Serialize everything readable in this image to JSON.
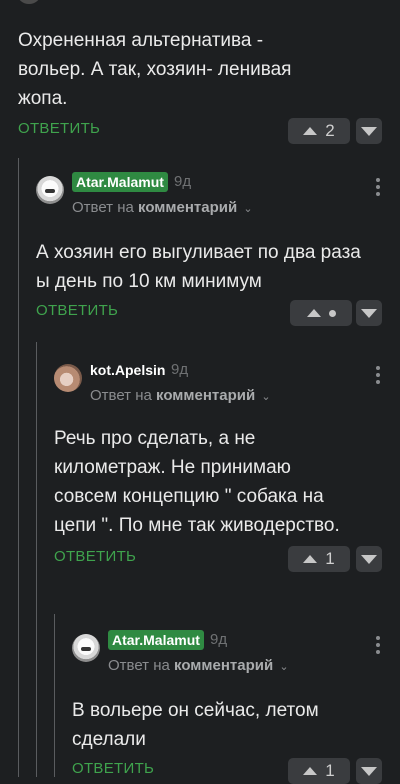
{
  "comments": [
    {
      "body": "Охрененная альтернатива - вольер. А так, хозяин- ленивая жопа.",
      "reply_label": "ОТВЕТИТЬ",
      "rating": "2"
    },
    {
      "username": "Atar.Malamut",
      "time": "9д",
      "reply_prefix": "Ответ на",
      "reply_target": "комментарий",
      "body": "А хозяин его выгуливает по два раза ы день по 10 км минимум",
      "reply_label": "ОТВЕТИТЬ",
      "rating": ""
    },
    {
      "username": "kot.Apelsin",
      "time": "9д",
      "reply_prefix": "Ответ на",
      "reply_target": "комментарий",
      "body": "Речь про сделать, а не километраж. Не принимаю совсем концепцию \" собака на цепи \". По мне так живодерство.",
      "reply_label": "ОТВЕТИТЬ",
      "rating": "1"
    },
    {
      "username": "Atar.Malamut",
      "time": "9д",
      "reply_prefix": "Ответ на",
      "reply_target": "комментарий",
      "body": "В вольере он сейчас, летом сделали",
      "reply_label": "ОТВЕТИТЬ",
      "rating": "1"
    }
  ],
  "icons": {
    "upvote": "triangle-up-icon",
    "downvote": "triangle-down-icon",
    "menu": "kebab-menu-icon",
    "chevron": "chevron-down-icon"
  },
  "colors": {
    "background": "#1d1f21",
    "accent_green": "#3fa34d",
    "username_badge": "#2f8a42",
    "vote_button": "#3a3c3f"
  }
}
